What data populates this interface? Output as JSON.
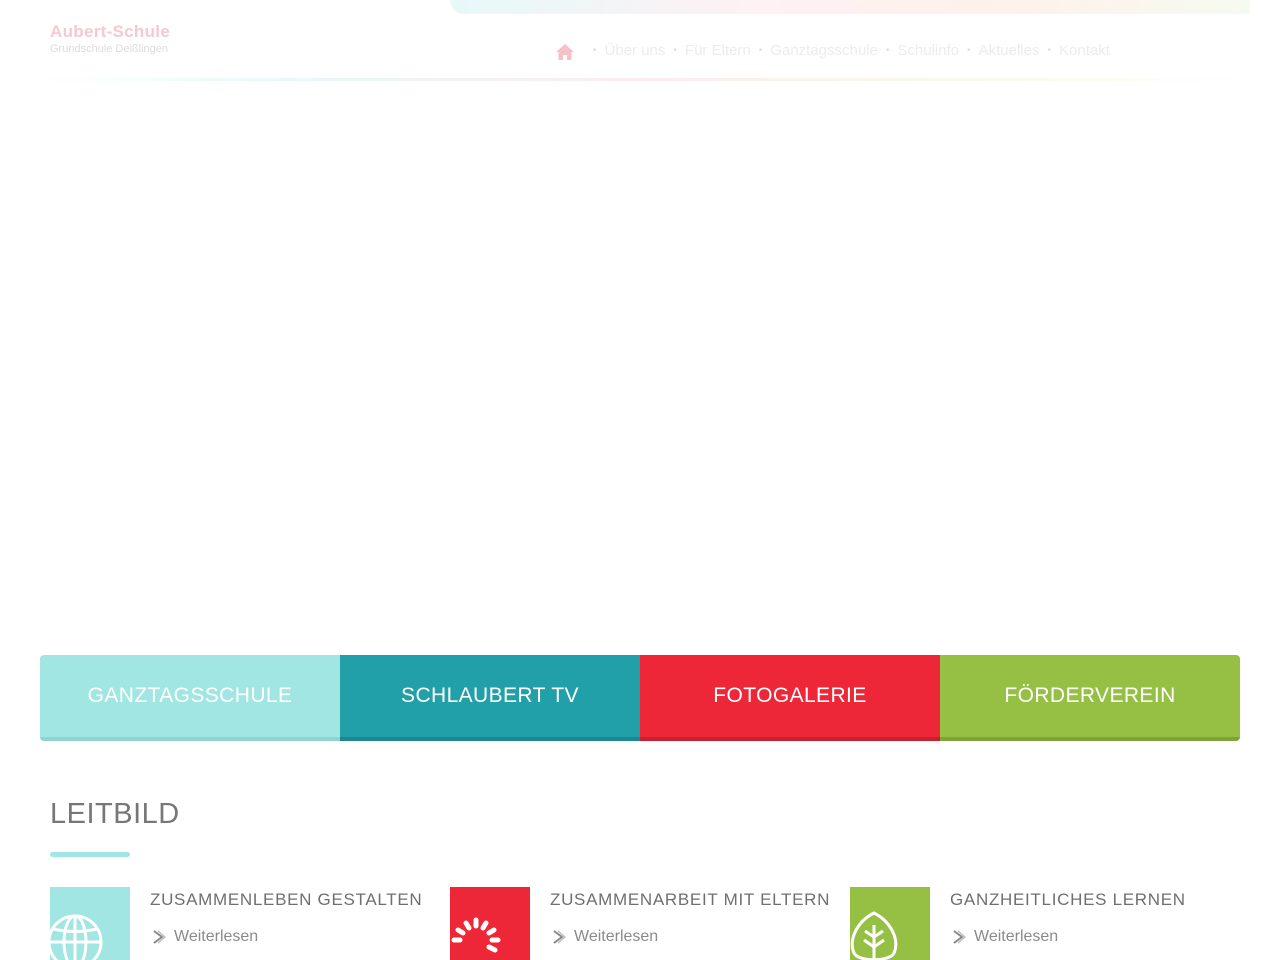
{
  "header": {
    "logo": {
      "name": "Aubert-Schule",
      "subtitle": "Grundschule Deißlingen"
    },
    "nav": [
      {
        "label": "Über uns"
      },
      {
        "label": "Für Eltern"
      },
      {
        "label": "Ganztagsschule"
      },
      {
        "label": "Schulinfo"
      },
      {
        "label": "Aktuelles"
      },
      {
        "label": "Kontakt"
      }
    ]
  },
  "tiles": [
    {
      "label": "GANZTAGSSCHULE",
      "color": "#a1e6e2"
    },
    {
      "label": "SCHLAUBERT TV",
      "color": "#22a0aa"
    },
    {
      "label": "FOTOGALERIE",
      "color": "#ee2738"
    },
    {
      "label": "FÖRDERVEREIN",
      "color": "#95c043"
    }
  ],
  "leitbild": {
    "title": "LEITBILD",
    "items": [
      {
        "title": "ZUSAMMENLEBEN GESTALTEN",
        "link": "Weiterlesen",
        "icon": "globe-icon",
        "color": "#a1e6e2"
      },
      {
        "title": "ZUSAMMENARBEIT MIT ELTERN",
        "link": "Weiterlesen",
        "icon": "sun-icon",
        "color": "#ee2738"
      },
      {
        "title": "GANZHEITLICHES LERNEN",
        "link": "Weiterlesen",
        "icon": "tree-icon",
        "color": "#95c043"
      }
    ]
  }
}
